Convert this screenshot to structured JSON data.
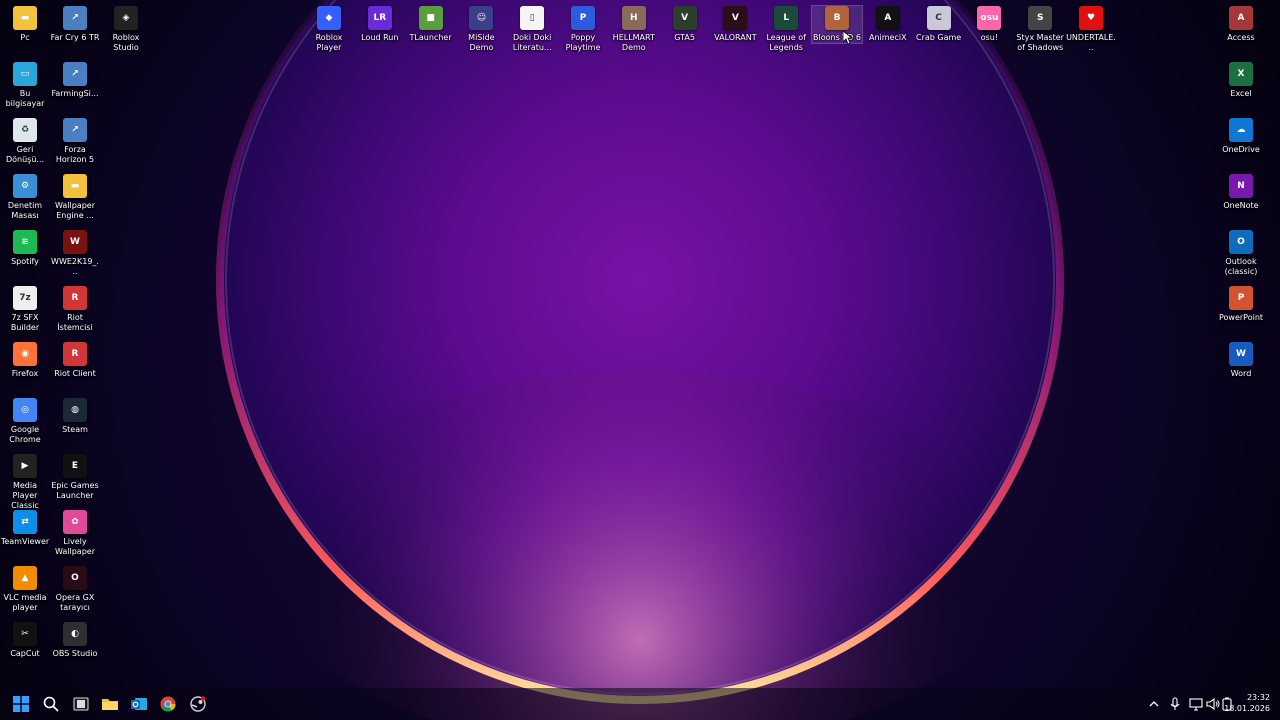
{
  "desktop": {
    "left_col1": [
      {
        "label": "Pc",
        "icon": "folder-icon",
        "color": "#f3c23c"
      },
      {
        "label": "Bu bilgisayar",
        "icon": "monitor-icon",
        "color": "#2aa7d8"
      },
      {
        "label": "Geri Dönüşü...",
        "icon": "recycle-bin-icon",
        "color": "#dfe7ee"
      },
      {
        "label": "Denetim Masası",
        "icon": "control-panel-icon",
        "color": "#3b8fd6"
      },
      {
        "label": "Spotify",
        "icon": "spotify-icon",
        "color": "#1db954"
      },
      {
        "label": "7z SFX Builder",
        "icon": "7z-icon",
        "color": "#eeeeee"
      },
      {
        "label": "Firefox",
        "icon": "firefox-icon",
        "color": "#ff7139"
      },
      {
        "label": "Google Chrome",
        "icon": "chrome-icon",
        "color": "#4285f4"
      },
      {
        "label": "Media Player Classic",
        "icon": "media-player-icon",
        "color": "#222222"
      },
      {
        "label": "TeamViewer",
        "icon": "teamviewer-icon",
        "color": "#0e8ee9"
      },
      {
        "label": "VLC media player",
        "icon": "vlc-icon",
        "color": "#f18c00"
      },
      {
        "label": "CapCut",
        "icon": "capcut-icon",
        "color": "#111111"
      }
    ],
    "left_col2": [
      {
        "label": "Far Cry 6 TR",
        "icon": "far-cry-icon",
        "color": "#4a7fc1"
      },
      {
        "label": "FarmingSi...",
        "icon": "farming-sim-icon",
        "color": "#4a7fc1"
      },
      {
        "label": "Forza Horizon 5",
        "icon": "forza-icon",
        "color": "#4a7fc1"
      },
      {
        "label": "Wallpaper Engine ...",
        "icon": "folder-icon",
        "color": "#f3c23c"
      },
      {
        "label": "WWE2K19_...",
        "icon": "wwe-icon",
        "color": "#7a1212"
      },
      {
        "label": "Riot İstemcisi",
        "icon": "riot-icon",
        "color": "#d13639"
      },
      {
        "label": "Riot Client",
        "icon": "riot-icon",
        "color": "#d13639"
      },
      {
        "label": "Steam",
        "icon": "steam-icon",
        "color": "#1b2838"
      },
      {
        "label": "Epic Games Launcher",
        "icon": "epic-games-icon",
        "color": "#111111"
      },
      {
        "label": "Lively Wallpaper",
        "icon": "lively-icon",
        "color": "#e04a9a"
      },
      {
        "label": "Opera GX tarayıcı",
        "icon": "opera-gx-icon",
        "color": "#2a0a14"
      },
      {
        "label": "OBS Studio",
        "icon": "obs-icon",
        "color": "#302e31"
      }
    ],
    "left_col3": [
      {
        "label": "Roblox Studio",
        "icon": "roblox-studio-icon",
        "color": "#222222"
      }
    ],
    "top_row": [
      {
        "label": "Roblox Player",
        "icon": "roblox-icon",
        "color": "#335fff"
      },
      {
        "label": "Loud Run",
        "icon": "loud-run-icon",
        "color": "#6b2bd9"
      },
      {
        "label": "TLauncher",
        "icon": "tlauncher-icon",
        "color": "#5a9d3c"
      },
      {
        "label": "MiSide Demo",
        "icon": "miside-icon",
        "color": "#3a3f8c"
      },
      {
        "label": "Doki Doki Literatu...",
        "icon": "file-icon",
        "color": "#f5f5f5"
      },
      {
        "label": "Poppy Playtime",
        "icon": "poppy-icon",
        "color": "#2c5cdb"
      },
      {
        "label": "HELLMART Demo",
        "icon": "hellmart-icon",
        "color": "#8a6a5a"
      },
      {
        "label": "GTA5",
        "icon": "gta5-icon",
        "color": "#2c3e2c"
      },
      {
        "label": "VALORANT",
        "icon": "valorant-icon",
        "color": "#2a0f18"
      },
      {
        "label": "League of Legends",
        "icon": "lol-icon",
        "color": "#1a4a3a"
      },
      {
        "label": "Bloons TD 6",
        "icon": "bloons-icon",
        "color": "#b0643c"
      },
      {
        "label": "AnimeciX",
        "icon": "animecix-icon",
        "color": "#111111"
      },
      {
        "label": "Crab Game",
        "icon": "crab-game-icon",
        "color": "#c8c8d8"
      },
      {
        "label": "osu!",
        "icon": "osu-icon",
        "color": "#ff66aa"
      },
      {
        "label": "Styx Master of Shadows",
        "icon": "styx-icon",
        "color": "#444444"
      },
      {
        "label": "UNDERTALE...",
        "icon": "heart-icon",
        "color": "#e01010"
      }
    ],
    "right_col": [
      {
        "label": "Access",
        "icon": "access-icon",
        "color": "#a4373a"
      },
      {
        "label": "Excel",
        "icon": "excel-icon",
        "color": "#1d6f42"
      },
      {
        "label": "OneDrive",
        "icon": "onedrive-icon",
        "color": "#0f78d4"
      },
      {
        "label": "OneNote",
        "icon": "onenote-icon",
        "color": "#7719aa"
      },
      {
        "label": "Outlook (classic)",
        "icon": "outlook-icon",
        "color": "#0f6cbd"
      },
      {
        "label": "PowerPoint",
        "icon": "powerpoint-icon",
        "color": "#d35230"
      },
      {
        "label": "Word",
        "icon": "word-icon",
        "color": "#185abd"
      }
    ]
  },
  "taskbar": {
    "pinned": [
      {
        "name": "start-button",
        "icon": "windows-start-icon",
        "color": "#3aa0ff"
      },
      {
        "name": "search-button",
        "icon": "search-icon",
        "color": "#ffffff"
      },
      {
        "name": "task-view-button",
        "icon": "task-view-icon",
        "color": "#ffffff"
      },
      {
        "name": "file-explorer-button",
        "icon": "folder-icon",
        "color": "#f3c23c"
      },
      {
        "name": "outlook-button",
        "icon": "outlook-icon",
        "color": "#0f6cbd"
      },
      {
        "name": "chrome-button",
        "icon": "chrome-icon",
        "color": "#4285f4"
      },
      {
        "name": "steam-button",
        "icon": "steam-icon",
        "color": "#cfd6df"
      }
    ],
    "clock": {
      "time": "23:32",
      "date": "18.01.2026"
    }
  }
}
